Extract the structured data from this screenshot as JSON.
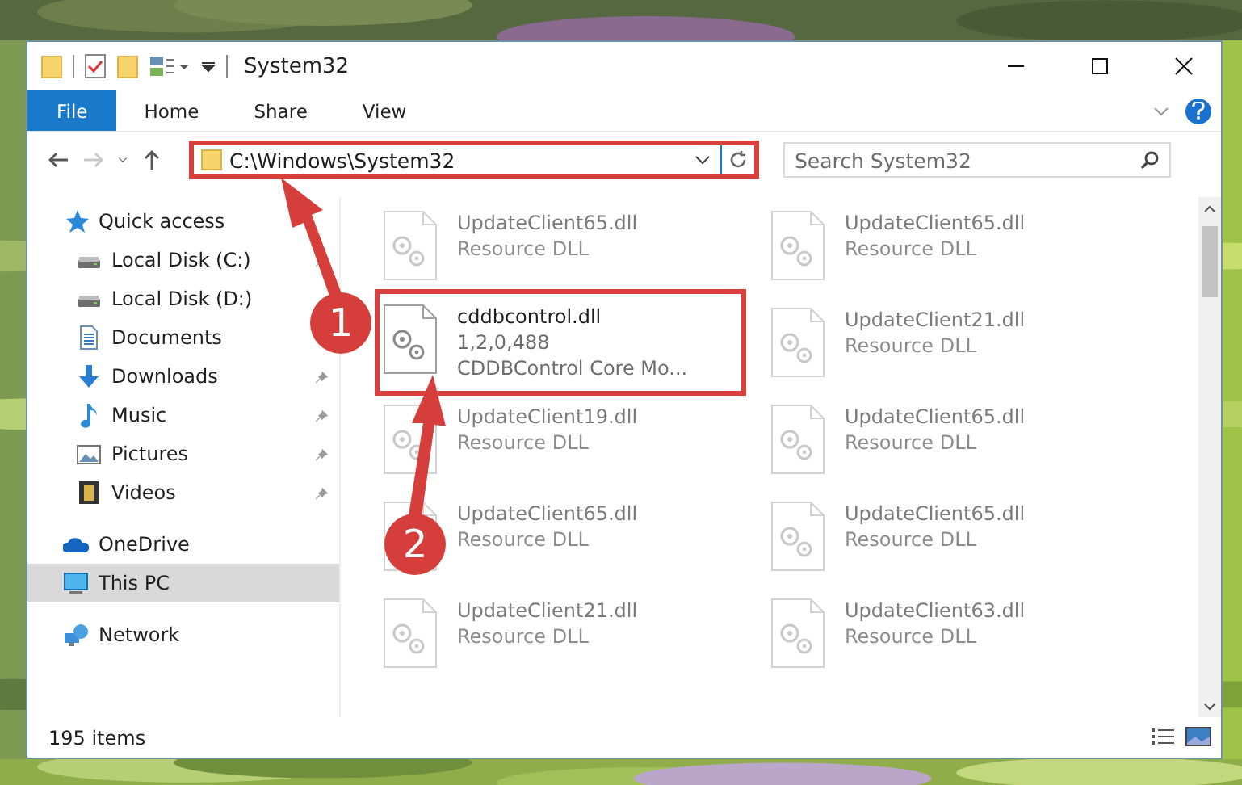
{
  "window": {
    "title": "System32"
  },
  "ribbon": {
    "tabs": [
      {
        "label": "File",
        "selected": true
      },
      {
        "label": "Home",
        "selected": false
      },
      {
        "label": "Share",
        "selected": false
      },
      {
        "label": "View",
        "selected": false
      }
    ]
  },
  "address_bar": {
    "path": "C:\\Windows\\System32",
    "highlighted": true
  },
  "search": {
    "placeholder": "Search System32"
  },
  "sidebar": {
    "items": [
      {
        "label": "Quick access",
        "kind": "star",
        "selected": false,
        "children": [
          {
            "label": "Local Disk (C:)",
            "kind": "drive",
            "pinned": true,
            "selected": false
          },
          {
            "label": "Local Disk (D:)",
            "kind": "drive",
            "pinned": false,
            "selected": false
          },
          {
            "label": "Documents",
            "kind": "document",
            "selected": false
          },
          {
            "label": "Downloads",
            "kind": "download",
            "pinned": true,
            "selected": false
          },
          {
            "label": "Music",
            "kind": "music",
            "pinned": true,
            "selected": false
          },
          {
            "label": "Pictures",
            "kind": "pictures",
            "pinned": true,
            "selected": false
          },
          {
            "label": "Videos",
            "kind": "videos",
            "pinned": true,
            "selected": false
          }
        ]
      },
      {
        "label": "OneDrive",
        "kind": "cloud",
        "selected": false
      },
      {
        "label": "This PC",
        "kind": "pc",
        "selected": true
      },
      {
        "label": "Network",
        "kind": "network",
        "selected": false
      }
    ]
  },
  "files": [
    {
      "name": "UpdateClient65.dll",
      "type": "Resource DLL",
      "dimmed": true,
      "highlighted": false
    },
    {
      "name": "UpdateClient65.dll",
      "type": "Resource DLL",
      "dimmed": true,
      "highlighted": false
    },
    {
      "name": "cddbcontrol.dll",
      "version": "1,2,0,488",
      "type": "CDDBControl Core Mo...",
      "dimmed": false,
      "highlighted": true
    },
    {
      "name": "UpdateClient21.dll",
      "type": "Resource DLL",
      "dimmed": true,
      "highlighted": false
    },
    {
      "name": "UpdateClient19.dll",
      "type": "Resource DLL",
      "dimmed": true,
      "highlighted": false
    },
    {
      "name": "UpdateClient65.dll",
      "type": "Resource DLL",
      "dimmed": true,
      "highlighted": false
    },
    {
      "name": "UpdateClient65.dll",
      "type": "Resource DLL",
      "dimmed": true,
      "highlighted": false
    },
    {
      "name": "UpdateClient65.dll",
      "type": "Resource DLL",
      "dimmed": true,
      "highlighted": false
    },
    {
      "name": "UpdateClient21.dll",
      "type": "Resource DLL",
      "dimmed": true,
      "highlighted": false
    },
    {
      "name": "UpdateClient63.dll",
      "type": "Resource DLL",
      "dimmed": true,
      "highlighted": false
    }
  ],
  "status_bar": {
    "item_count": "195 items"
  },
  "annotations": [
    {
      "number": "1"
    },
    {
      "number": "2"
    }
  ]
}
